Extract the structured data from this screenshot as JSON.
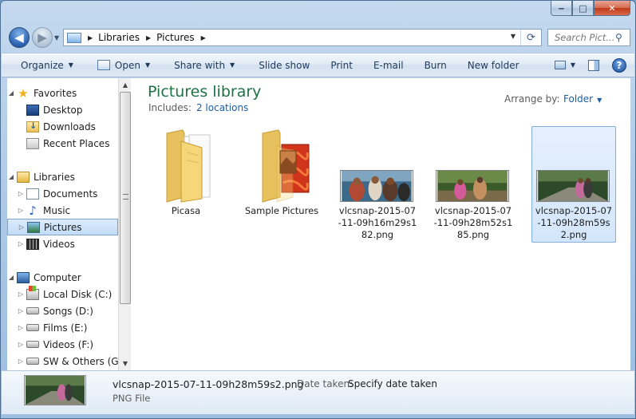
{
  "window": {
    "minimize_glyph": "‒",
    "maximize_glyph": "□",
    "close_glyph": "✕"
  },
  "address": {
    "back_icon": "back-arrow-icon",
    "forward_icon": "forward-arrow-icon",
    "crumbs": [
      "Libraries",
      "Pictures"
    ],
    "search_placeholder": "Search Pict...",
    "refresh_glyph": "⟳",
    "search_glyph": "⚲"
  },
  "toolbar": {
    "organize": "Organize",
    "open": "Open",
    "share_with": "Share with",
    "slide_show": "Slide show",
    "print": "Print",
    "email": "E-mail",
    "burn": "Burn",
    "new_folder": "New folder",
    "help": "?"
  },
  "sidebar": {
    "favorites": "Favorites",
    "desktop": "Desktop",
    "downloads": "Downloads",
    "recent_places": "Recent Places",
    "libraries": "Libraries",
    "documents": "Documents",
    "music": "Music",
    "pictures": "Pictures",
    "videos": "Videos",
    "computer": "Computer",
    "drives": [
      "Local Disk (C:)",
      "Songs (D:)",
      "Films (E:)",
      "Videos (F:)",
      "SW & Others (G:)"
    ]
  },
  "content": {
    "title": "Pictures library",
    "includes_label": "Includes:",
    "includes_link": "2 locations",
    "arrange_label": "Arrange by:",
    "arrange_value": "Folder",
    "items": [
      {
        "name": "Picasa",
        "kind": "folder"
      },
      {
        "name": "Sample Pictures",
        "kind": "folder"
      },
      {
        "name": "vlcsnap-2015-07-11-09h16m29s182.png",
        "kind": "image"
      },
      {
        "name": "vlcsnap-2015-07-11-09h28m52s185.png",
        "kind": "image"
      },
      {
        "name": "vlcsnap-2015-07-11-09h28m59s2.png",
        "kind": "image",
        "selected": true
      }
    ]
  },
  "details": {
    "filename": "vlcsnap-2015-07-11-09h28m59s2.png",
    "type": "PNG File",
    "date_label": "Date taken:",
    "date_value": "Specify date taken"
  },
  "colors": {
    "library_title": "#1e7145",
    "link": "#1a5ea8",
    "selection_border": "#84acdd",
    "selection_fill": "#d4e6fb"
  }
}
